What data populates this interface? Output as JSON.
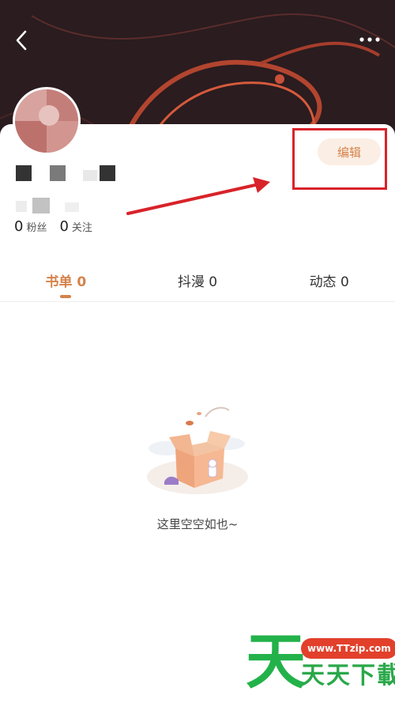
{
  "header": {
    "back_icon": "chevron-left-icon",
    "more_icon": "more-dots-icon",
    "background_color": "#2a1c1f",
    "accent_swirl_color": "#c8503a"
  },
  "profile": {
    "edit_label": "编辑",
    "stats": [
      {
        "value": "0",
        "label": "粉丝"
      },
      {
        "value": "0",
        "label": "关注"
      }
    ]
  },
  "tabs": [
    {
      "label": "书单 0",
      "active": true
    },
    {
      "label": "抖漫 0",
      "active": false
    },
    {
      "label": "动态 0",
      "active": false
    }
  ],
  "empty_state": {
    "message": "这里空空如也~",
    "illustration": "empty-box-illustration"
  },
  "annotation": {
    "highlight_color": "#d8232a"
  },
  "watermark": {
    "big_char": "天",
    "url": "www.TTzip.com",
    "text": "天天下載"
  },
  "colors": {
    "accent": "#d4834c",
    "edit_bg": "#fbeee4",
    "watermark_green": "#23b24a",
    "watermark_red": "#e2402b"
  }
}
